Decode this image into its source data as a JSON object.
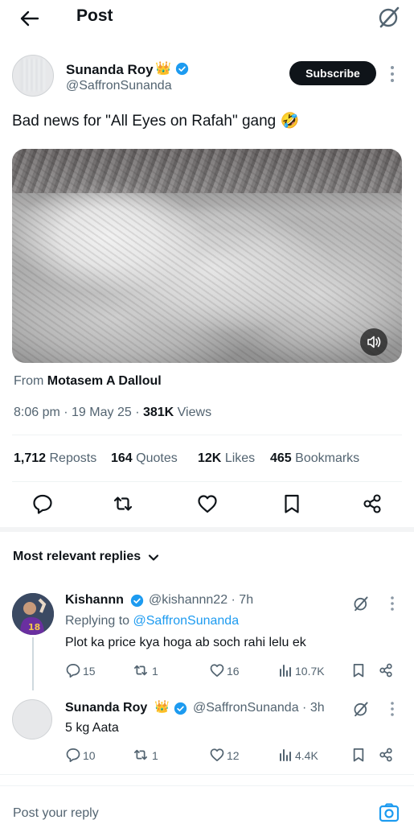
{
  "header": {
    "title": "Post",
    "back_icon": "arrow-left-icon",
    "grok_icon": "grok-icon"
  },
  "post": {
    "author_name": "Sunanda Roy",
    "author_badge": "👑",
    "author_handle": "@SaffronSunanda",
    "subscribe_label": "Subscribe",
    "text": "Bad news for \"All Eyes on Rafah\" gang 🤣",
    "from_prefix": "From",
    "from_source": "Motasem A Dalloul",
    "time": "8:06 pm",
    "date": "19 May 25",
    "views_count": "381K",
    "views_label": "Views",
    "reposts_count": "1,712",
    "reposts_label": "Reposts",
    "quotes_count": "164",
    "quotes_label": "Quotes",
    "likes_count": "12K",
    "likes_label": "Likes",
    "bookmarks_count": "465",
    "bookmarks_label": "Bookmarks"
  },
  "replies_header": "Most relevant replies",
  "replies": [
    {
      "name": "Kishannn",
      "handle_time": "@kishannn22 · 7h",
      "replying_prefix": "Replying to",
      "replying_to": "@SaffronSunanda",
      "text": "Plot ka price kya hoga ab soch rahi lelu ek",
      "replies": "15",
      "reposts": "1",
      "likes": "16",
      "views": "10.7K"
    },
    {
      "name": "Sunanda Roy",
      "badge": "👑",
      "handle_time": "@SaffronSunanda · 3h",
      "text": "5 kg Aata",
      "replies": "10",
      "reposts": "1",
      "likes": "12",
      "views": "4.4K"
    }
  ],
  "composer": {
    "placeholder": "Post your reply",
    "camera_icon": "camera-icon"
  },
  "colors": {
    "text": "#0f1419",
    "secondary": "#536471",
    "link": "#1d9bf0",
    "verified": "#1d9bf0",
    "subscribe_bg": "#0f1419"
  }
}
